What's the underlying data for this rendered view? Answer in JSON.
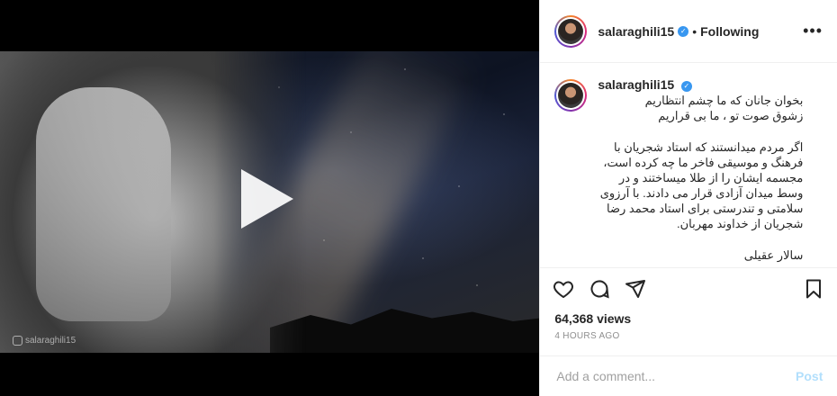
{
  "post": {
    "username": "salaraghili15",
    "follow_status": "Following",
    "separator": "•",
    "more_label": "•••",
    "verified_glyph": "✓",
    "caption": {
      "line1": "بخوان جانان که ما چشم انتظاریم",
      "line2": "زشوق صوت تو ، ما بی قراریم",
      "para": "اگر مردم میدانستند که استاد شجریان با فرهنگ و موسیقی فاخر ما چه کرده است، مجسمه ایشان را از طلا میساختند و در وسط میدان آزادی قرار می دادند. با آرزوی سلامتی و تندرستی برای استاد محمد رضا شجریان از خداوند مهربان.",
      "signature": "سالار عقیلی"
    },
    "views": "64,368 views",
    "time": "4 HOURS AGO",
    "comment_placeholder": "Add a comment...",
    "post_label": "Post",
    "watermark": "salaraghili15"
  },
  "icons": {
    "verified": "verified-badge-icon",
    "like": "heart-icon",
    "comment": "comment-icon",
    "share": "paper-plane-icon",
    "save": "bookmark-icon",
    "play": "play-icon"
  },
  "colors": {
    "verified": "#3897f0",
    "text": "#262626",
    "muted": "#8e8e8e",
    "post_disabled": "#b2dffc"
  }
}
